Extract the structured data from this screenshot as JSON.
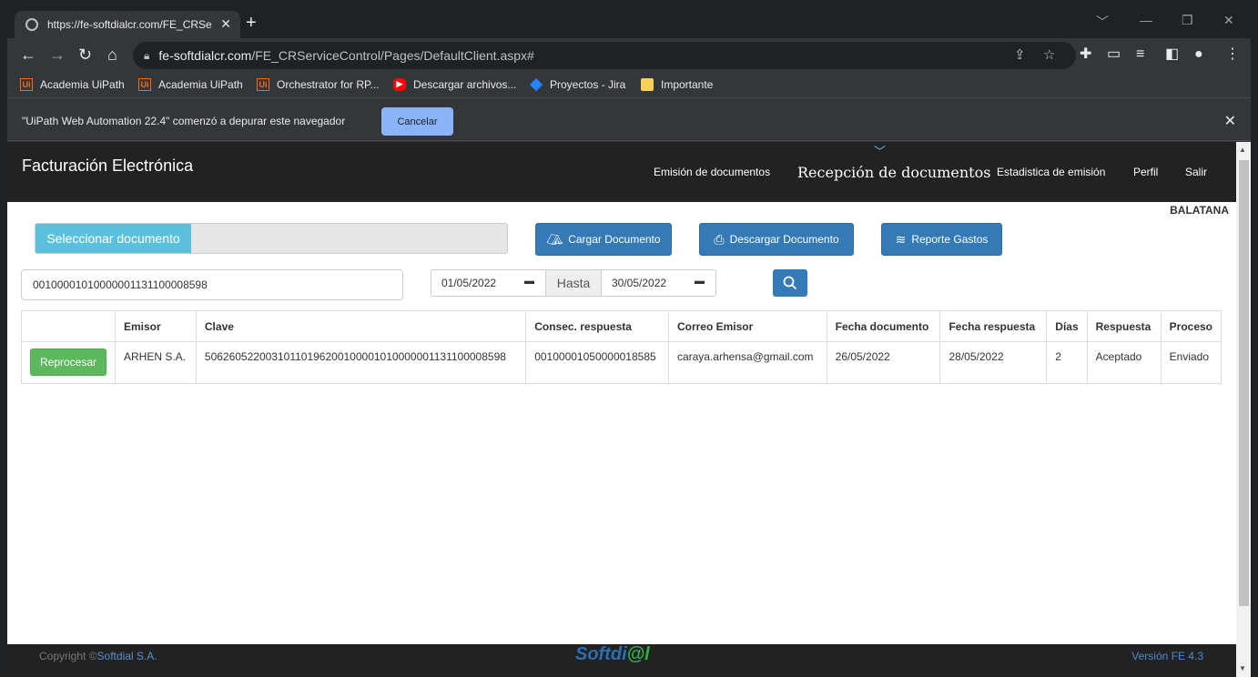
{
  "browser": {
    "tab_title": "https://fe-softdialcr.com/FE_CRSe",
    "url_host": "fe-softdialcr.com",
    "url_path": "/FE_CRServiceControl/Pages/DefaultClient.aspx#",
    "bookmarks": [
      {
        "label": "Academia UiPath",
        "icon": "uipath-icon"
      },
      {
        "label": "Academia UiPath",
        "icon": "uipath-icon"
      },
      {
        "label": "Orchestrator for RP...",
        "icon": "uipath-icon"
      },
      {
        "label": "Descargar archivos...",
        "icon": "youtube-icon"
      },
      {
        "label": "Proyectos - Jira",
        "icon": "jira-icon"
      },
      {
        "label": "Importante",
        "icon": "folder-icon"
      }
    ],
    "infobar_message": "\"UiPath Web Automation 22.4\" comenzó a depurar este navegador",
    "infobar_cancel": "Cancelar"
  },
  "app": {
    "brand": "Facturación Electrónica",
    "nav": {
      "emision": "Emisión de documentos",
      "recepcion": "Recepción de documentos",
      "estadistica": "Estadistica de emisión",
      "perfil": "Perfil",
      "salir": "Salir"
    },
    "company": "BALATANA",
    "select_document": "Seleccionar documento",
    "buttons": {
      "cargar": "Cargar Documento",
      "descargar": "Descargar Documento",
      "reporte": "Reporte Gastos"
    },
    "search_value": "00100001010000001131100008598",
    "date_from": "01/05/2022",
    "date_to_label": "Hasta",
    "date_to": "30/05/2022"
  },
  "table": {
    "headers": [
      "",
      "Emisor",
      "Clave",
      "Consec. respuesta",
      "Correo Emisor",
      "Fecha documento",
      "Fecha respuesta",
      "Días",
      "Respuesta",
      "Proceso"
    ],
    "rows": [
      {
        "action": "Reprocesar",
        "emisor": "ARHEN S.A.",
        "clave": "50626052200310110196200100001010000001131100008598",
        "consec": "00100001050000018585",
        "correo": "caraya.arhensa@gmail.com",
        "fecha_doc": "26/05/2022",
        "fecha_resp": "28/05/2022",
        "dias": "2",
        "respuesta": "Aceptado",
        "proceso": "Enviado"
      }
    ]
  },
  "footer": {
    "copyright": "Copyright ©",
    "company_link": "Softdial S.A.",
    "logo_a": "Softdi",
    "logo_b": "@l",
    "version": "Versión FE 4.3"
  }
}
